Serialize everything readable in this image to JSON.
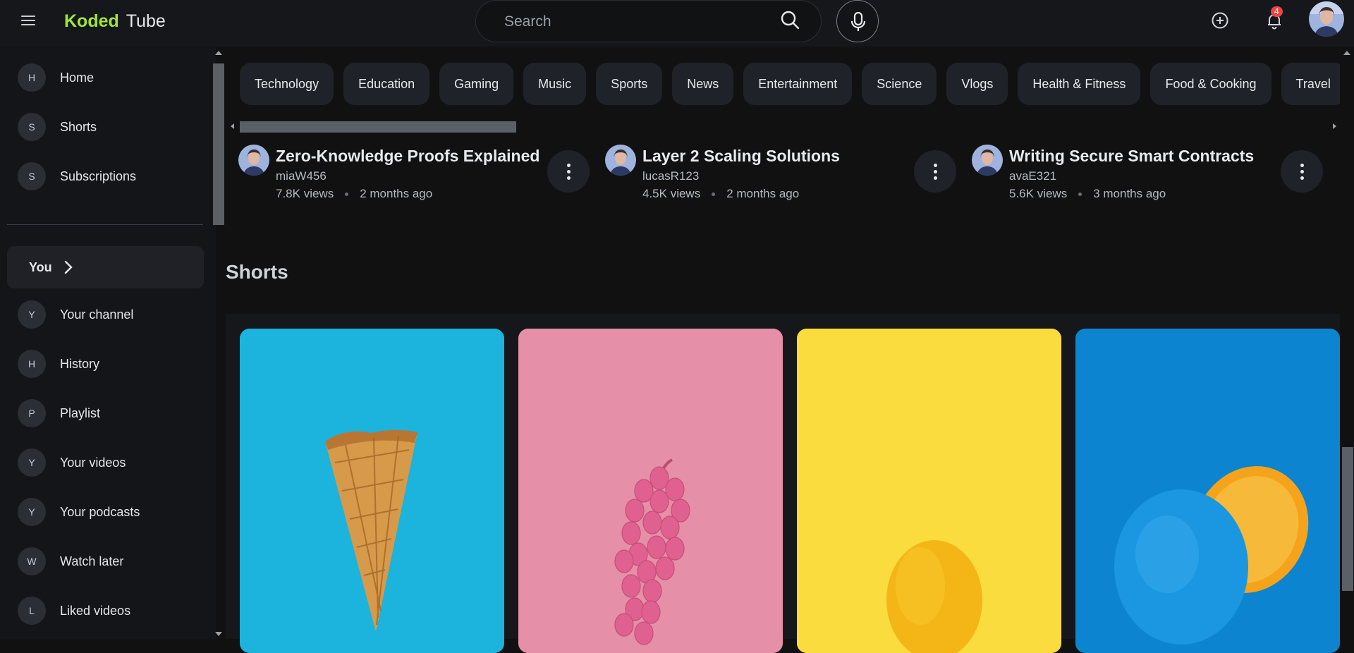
{
  "header": {
    "logo_first": "Koded",
    "logo_second": "Tube",
    "search_placeholder": "Search",
    "notification_count": "4",
    "icons": [
      "menu-icon",
      "search-icon",
      "mic-icon",
      "add-circle-icon",
      "bell-icon",
      "avatar"
    ]
  },
  "sidebar": {
    "top_items": [
      {
        "letter": "H",
        "label": "Home"
      },
      {
        "letter": "S",
        "label": "Shorts"
      },
      {
        "letter": "S",
        "label": "Subscriptions"
      }
    ],
    "you_label": "You",
    "you_items": [
      {
        "letter": "Y",
        "label": "Your channel"
      },
      {
        "letter": "H",
        "label": "History"
      },
      {
        "letter": "P",
        "label": "Playlist"
      },
      {
        "letter": "Y",
        "label": "Your videos"
      },
      {
        "letter": "Y",
        "label": "Your podcasts"
      },
      {
        "letter": "W",
        "label": "Watch later"
      },
      {
        "letter": "L",
        "label": "Liked videos"
      }
    ]
  },
  "chips": [
    "Technology",
    "Education",
    "Gaming",
    "Music",
    "Sports",
    "News",
    "Entertainment",
    "Science",
    "Vlogs",
    "Health & Fitness",
    "Food & Cooking",
    "Travel"
  ],
  "videos": [
    {
      "title": "Zero-Knowledge Proofs Explained",
      "channel": "miaW456",
      "views": "7.8K views",
      "age": "2 months ago"
    },
    {
      "title": "Layer 2 Scaling Solutions",
      "channel": "lucasR123",
      "views": "4.5K views",
      "age": "2 months ago"
    },
    {
      "title": "Writing Secure Smart Contracts",
      "channel": "avaE321",
      "views": "5.6K views",
      "age": "3 months ago"
    }
  ],
  "shorts_title": "Shorts",
  "shorts": [
    {
      "subject": "ice cream cone",
      "bg": "#1cb3dc"
    },
    {
      "subject": "pink grapes",
      "bg": "#e58fa8"
    },
    {
      "subject": "lemon",
      "bg": "#fbdc3f"
    },
    {
      "subject": "blue orange",
      "bg": "#0c84cf"
    }
  ],
  "colors": {
    "accent": "#a3e635",
    "badge": "#ef4444",
    "background": "#111112"
  }
}
